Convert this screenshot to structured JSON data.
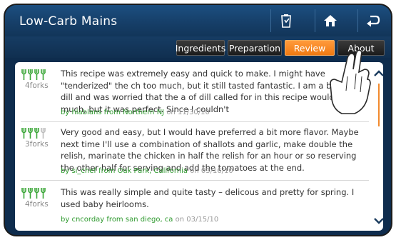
{
  "header": {
    "title": "Low-Carb Mains",
    "buttons": [
      {
        "name": "recipe-list-icon"
      },
      {
        "name": "home-icon"
      },
      {
        "name": "back-icon"
      }
    ]
  },
  "tabs": [
    {
      "label": "Ingredients"
    },
    {
      "label": "Preparation"
    },
    {
      "label": "Review",
      "active": true
    },
    {
      "label": "About"
    }
  ],
  "reviews": [
    {
      "rating": 4,
      "rating_label": "4forks",
      "text": "This recipe was extremely easy and quick to make. I might have \"tenderized\" the ch too much, but it still tasted fantastic. I am a big fan of dill and was worried that the a of dill called for in this recipe would be too much, but it was perfect. Since I couldn't",
      "byline": "by hlablans from Northern NJ",
      "date_prefix": "on",
      "date": "11/30/10"
    },
    {
      "rating": 3,
      "rating_label": "3forks",
      "text": "Very good and easy, but I would have preferred a bit more flavor. Maybe next time I'll use a combination of shallots and garlic, make double the relish, marinate the chicken in half the relish for an hour or so reserving the other half for serving and add the tomatoes at the end.",
      "byline": "by si_chef from Oak Park, California",
      "date_prefix": "on",
      "date": "03/16/10"
    },
    {
      "rating": 4,
      "rating_label": "4forks",
      "text": "This was really simple and quite tasty – delicous and pretty for spring. I used baby heirlooms.",
      "byline": "by cncorday from san diego, ca",
      "date_prefix": "on",
      "date": "03/15/10"
    }
  ],
  "scroll": {
    "position": 0.0
  },
  "colors": {
    "accent": "#f28a2e",
    "fork_active": "#3aa637",
    "fork_inactive": "#bdbdbd",
    "byline": "#2f9a2f",
    "header_bg": "#163f69"
  }
}
